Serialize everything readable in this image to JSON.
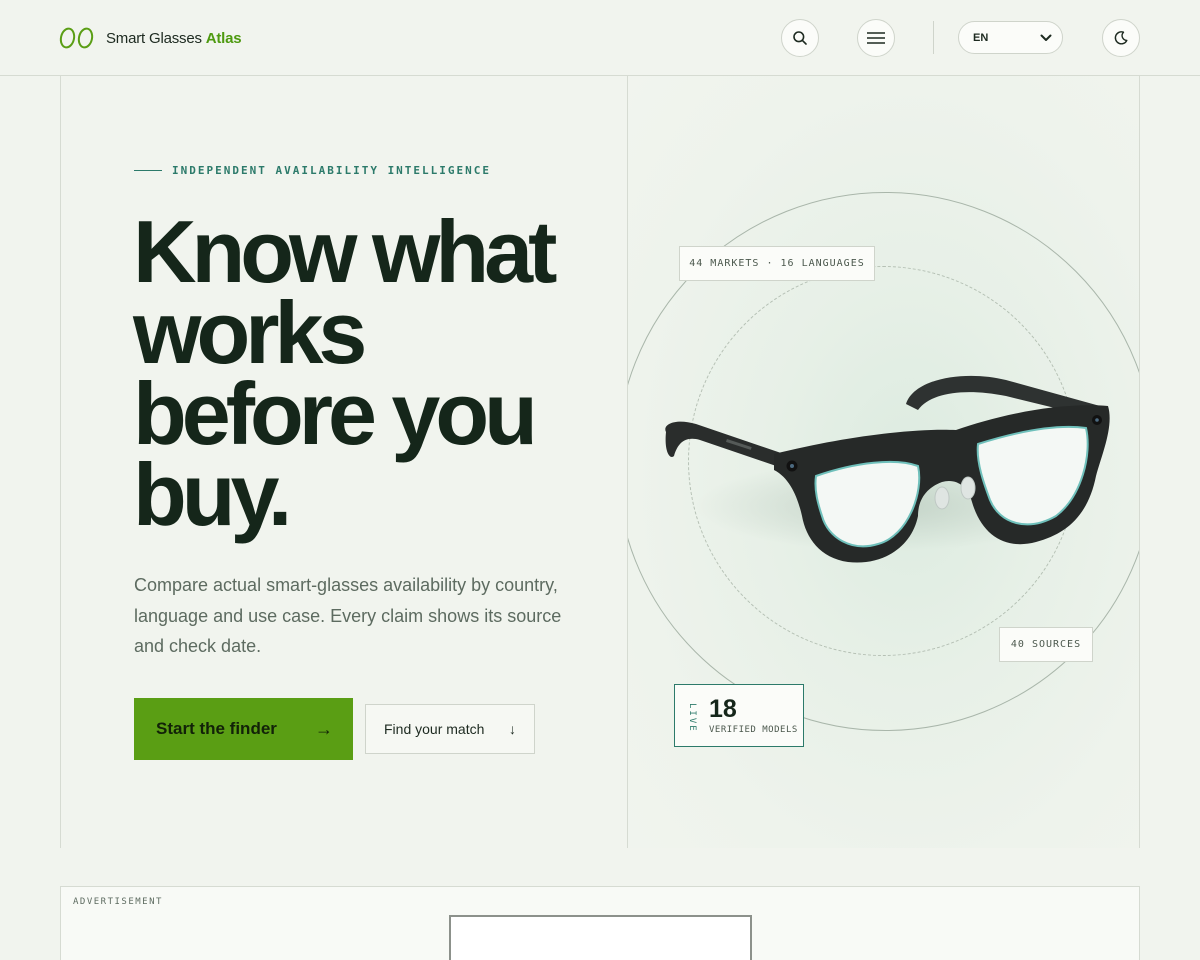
{
  "header": {
    "brand_prefix": "Smart Glasses ",
    "brand_accent": "Atlas",
    "logo_icon": "eyeglasses-logo-icon",
    "search_icon": "search-icon",
    "menu_icon": "menu-icon",
    "language": {
      "selected": "EN"
    },
    "theme_icon": "moon-icon"
  },
  "hero": {
    "eyebrow": "INDEPENDENT AVAILABILITY INTELLIGENCE",
    "headline_lines": [
      "Know what",
      "works",
      "before you",
      "buy."
    ],
    "lead": "Compare actual smart-glasses availability by country, language and use case. Every claim shows its source and check date.",
    "cta_primary": {
      "label": "Start the finder",
      "arrow": "→"
    },
    "cta_secondary": {
      "label": "Find your match",
      "arrow": "↓"
    },
    "chips": {
      "markets": "44 MARKETS · 16 LANGUAGES",
      "sources": "40 SOURCES"
    },
    "stat": {
      "live": "LIVE",
      "value": "18",
      "label": "VERIFIED MODELS"
    }
  },
  "advertisement": {
    "label": "ADVERTISEMENT"
  },
  "colors": {
    "accent": "#5a9e14",
    "teal": "#2c7a6a",
    "ink": "#15261a",
    "background": "#f1f4ee"
  }
}
